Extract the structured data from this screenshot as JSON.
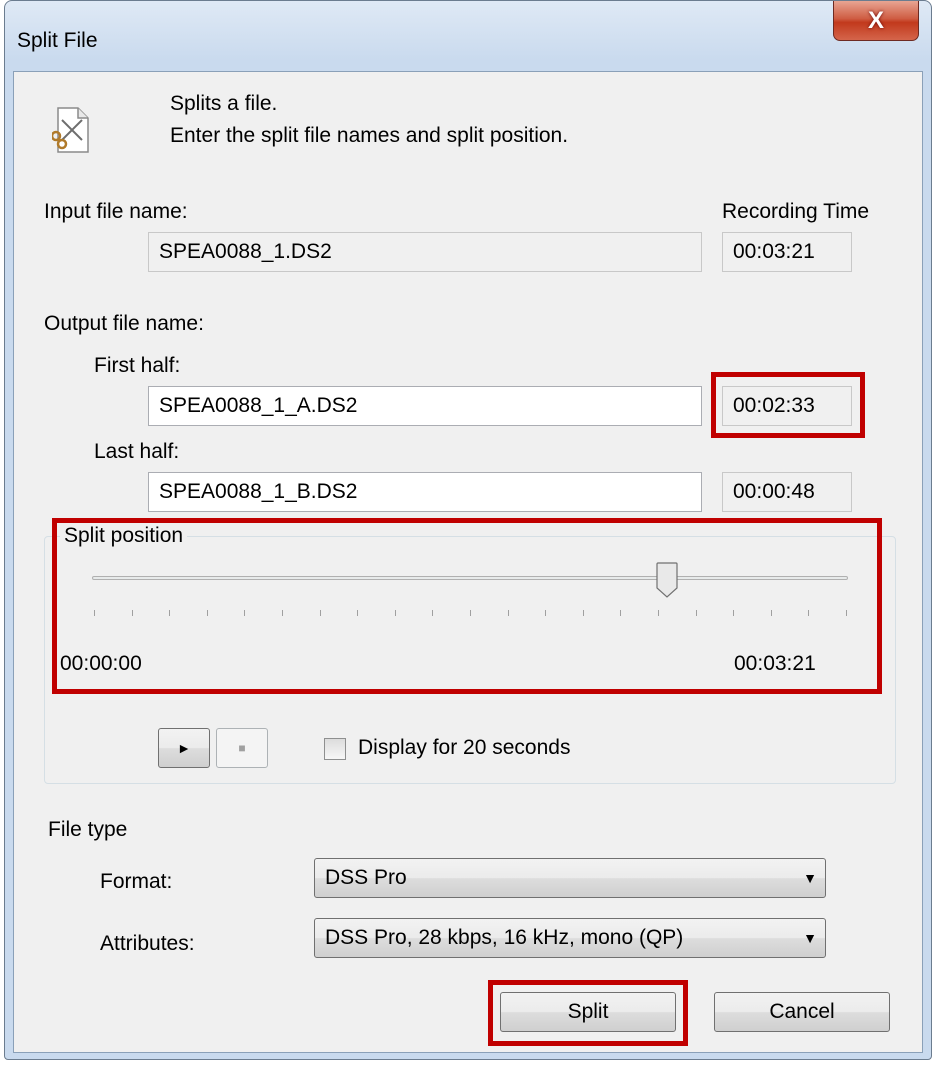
{
  "window": {
    "title": "Split File",
    "close_symbol": "X"
  },
  "header": {
    "line1": "Splits a file.",
    "line2": "Enter the split file names and split position."
  },
  "input": {
    "label": "Input file name:",
    "value": "SPEA0088_1.DS2",
    "time_label": "Recording Time",
    "time_value": "00:03:21"
  },
  "output": {
    "label": "Output file name:",
    "first_label": "First half:",
    "first_value": "SPEA0088_1_A.DS2",
    "first_time": "00:02:33",
    "last_label": "Last half:",
    "last_value": "SPEA0088_1_B.DS2",
    "last_time": "00:00:48"
  },
  "split": {
    "caption": "Split position",
    "start_time": "00:00:00",
    "end_time": "00:03:21",
    "position_fraction": 0.761,
    "tick_count": 20,
    "play_symbol": "►",
    "stop_symbol": "■",
    "display_label": "Display for 20 seconds",
    "display_checked": false
  },
  "filetype": {
    "label": "File type",
    "format_label": "Format:",
    "format_value": "DSS Pro",
    "attributes_label": "Attributes:",
    "attributes_value": "DSS Pro, 28 kbps, 16 kHz, mono (QP)",
    "dropdown_symbol": "▼"
  },
  "buttons": {
    "split": "Split",
    "cancel": "Cancel"
  },
  "colors": {
    "highlight": "#c00000",
    "close": "#c2391c",
    "window": "#c9daee"
  }
}
